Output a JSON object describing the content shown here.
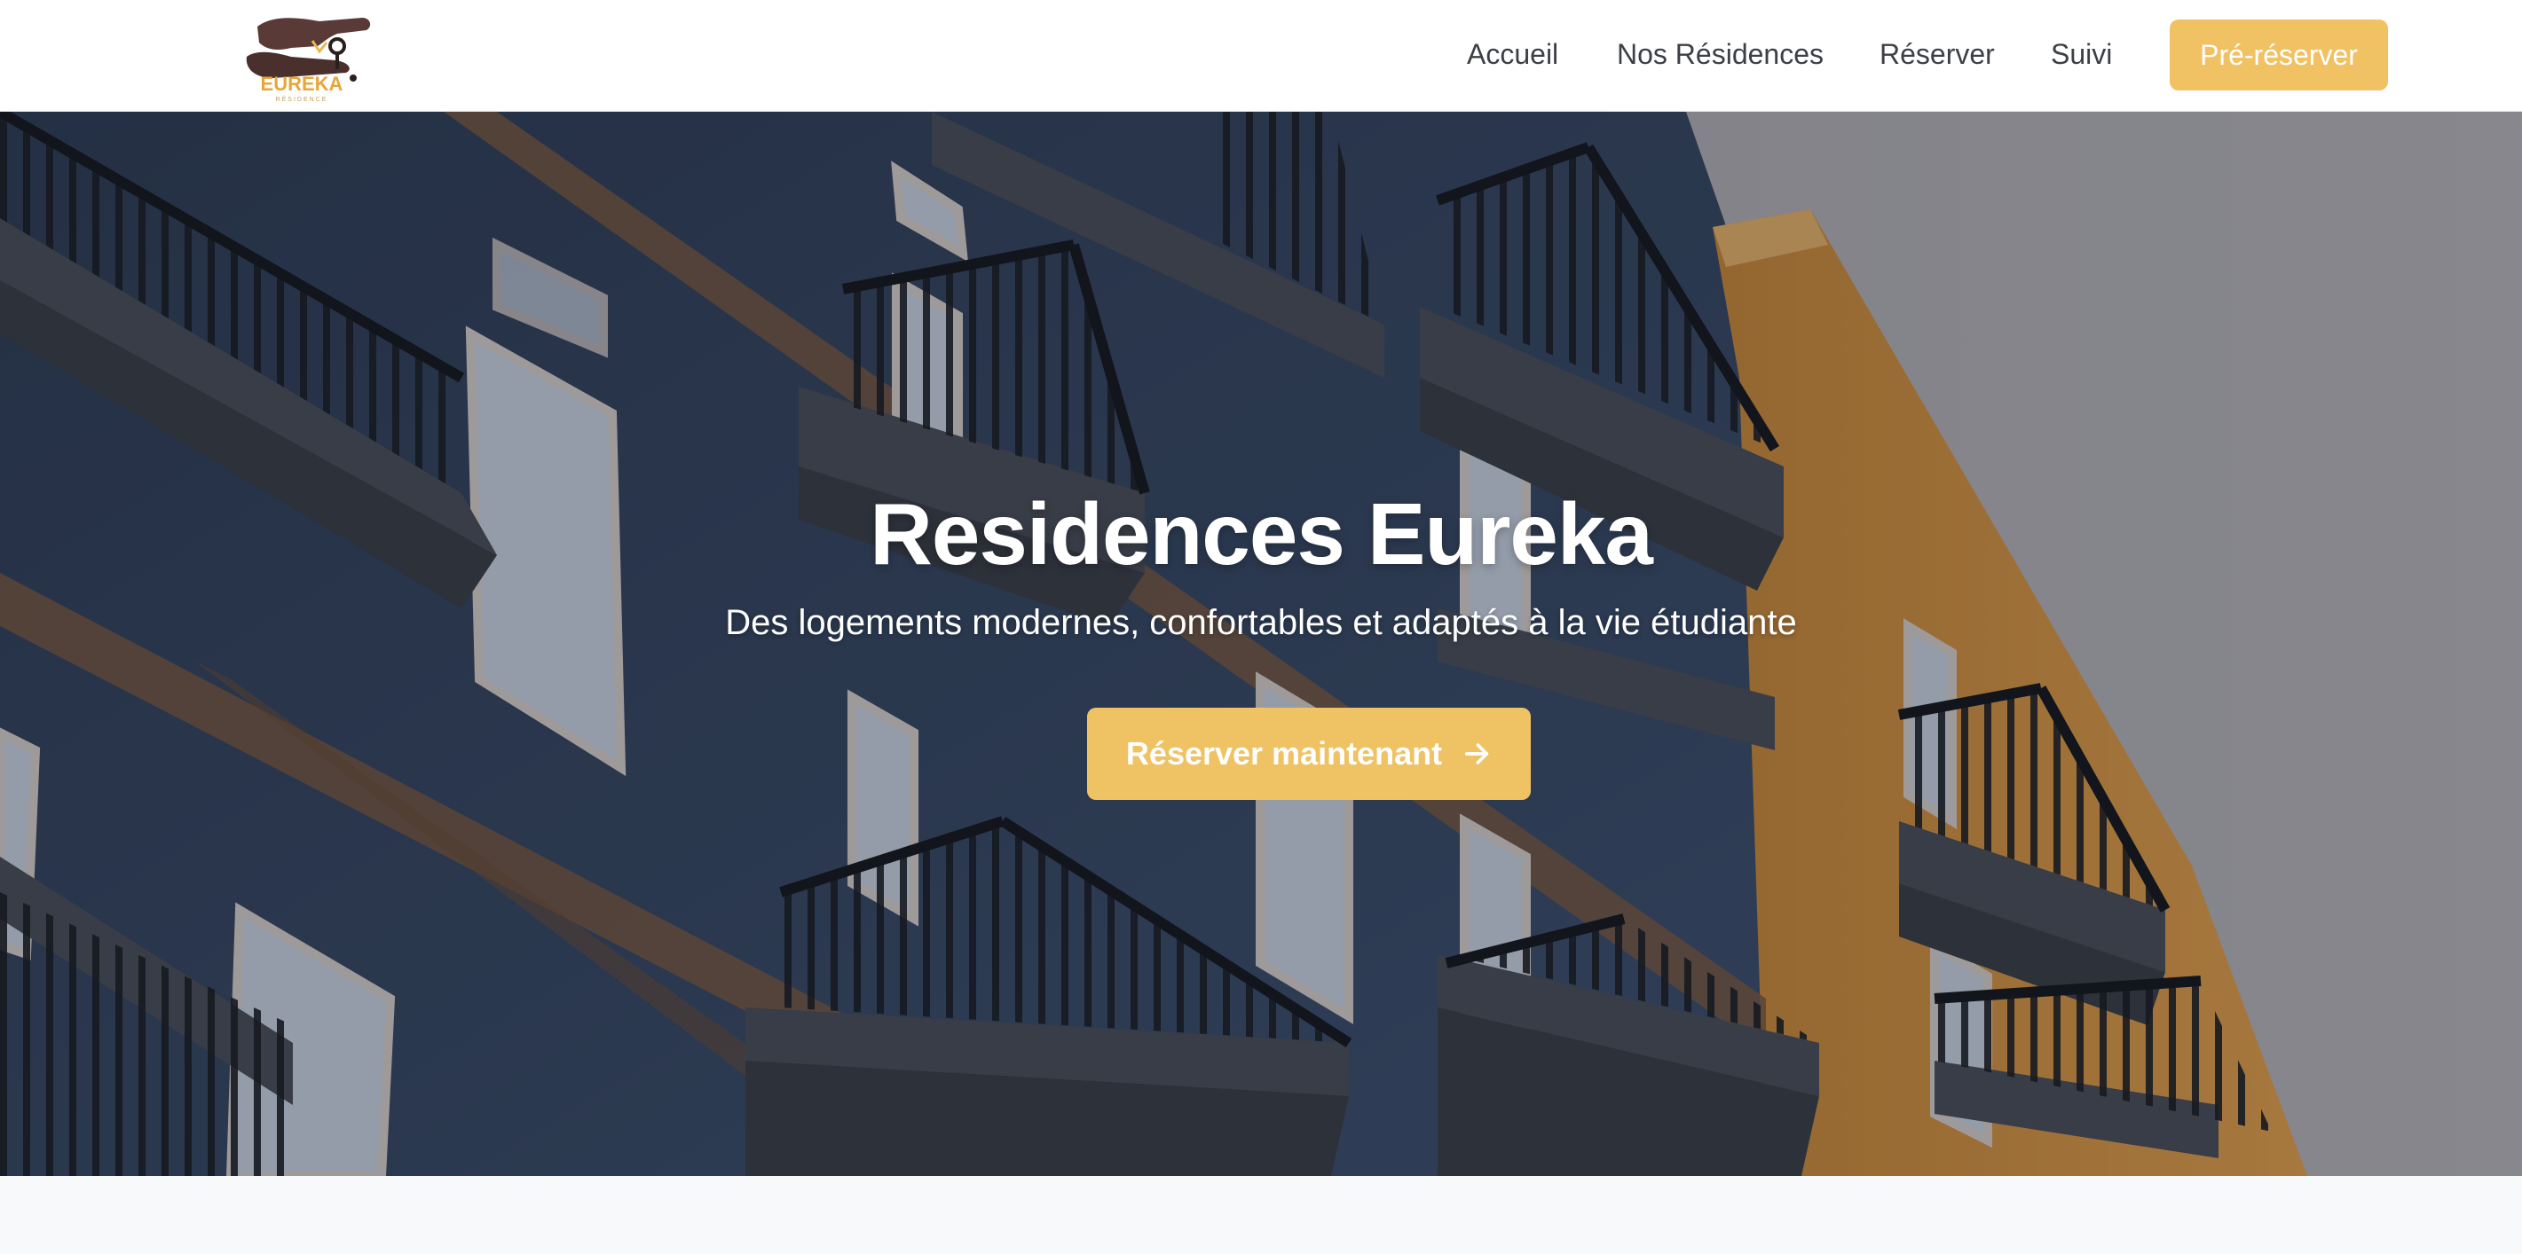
{
  "brand": {
    "logo_text": "EUREKA",
    "logo_subtext": "RÉSIDENCE"
  },
  "nav": {
    "items": [
      {
        "label": "Accueil"
      },
      {
        "label": "Nos Résidences"
      },
      {
        "label": "Réserver"
      },
      {
        "label": "Suivi"
      }
    ],
    "cta_label": "Pré-réserver"
  },
  "hero": {
    "title": "Residences Eureka",
    "subtitle": "Des logements modernes, confortables et adaptés à la vie étudiante",
    "button_label": "Réserver maintenant",
    "button_icon": "arrow-right-icon"
  },
  "colors": {
    "accent": "#efc263",
    "nav_text": "#3c3f46",
    "header_bg": "#ffffff",
    "page_bg": "#f8f9fb"
  }
}
